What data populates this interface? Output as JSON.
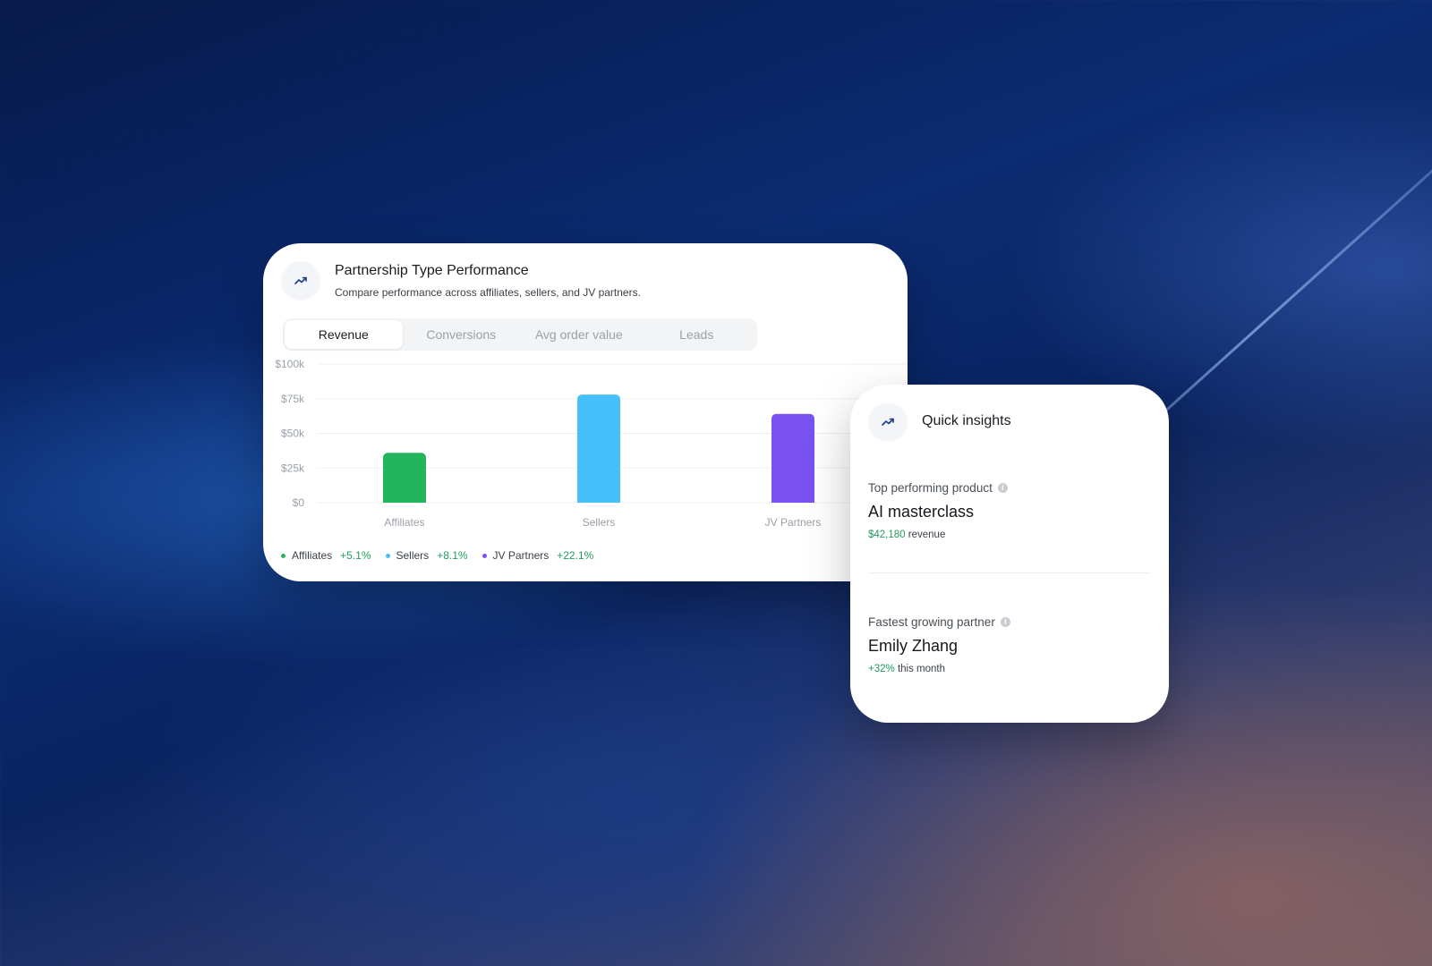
{
  "performance_card": {
    "title": "Partnership Type Performance",
    "subtitle": "Compare performance across affiliates, sellers, and JV partners.",
    "icon": "trending-up-icon",
    "tabs": [
      {
        "label": "Revenue",
        "active": true
      },
      {
        "label": "Conversions",
        "active": false
      },
      {
        "label": "Avg order value",
        "active": false
      },
      {
        "label": "Leads",
        "active": false
      }
    ],
    "legend": [
      {
        "name": "Affiliates",
        "change": "+5.1%",
        "color": "#22b55e"
      },
      {
        "name": "Sellers",
        "change": "+8.1%",
        "color": "#45c0fa"
      },
      {
        "name": "JV Partners",
        "change": "+22.1%",
        "color": "#7b52f2"
      }
    ]
  },
  "chart_data": {
    "type": "bar",
    "categories": [
      "Affiliates",
      "Sellers",
      "JV Partners"
    ],
    "values": [
      36000,
      78000,
      64000
    ],
    "colors": [
      "#22b55e",
      "#45c0fa",
      "#7b52f2"
    ],
    "ylim": [
      0,
      100000
    ],
    "yticks": [
      {
        "value": 0,
        "label": "$0"
      },
      {
        "value": 25000,
        "label": "$25k"
      },
      {
        "value": 50000,
        "label": "$50k"
      },
      {
        "value": 75000,
        "label": "$75k"
      },
      {
        "value": 100000,
        "label": "$100k"
      }
    ],
    "grid": true
  },
  "insights_card": {
    "title": "Quick insights",
    "icon": "trending-up-icon",
    "top_product": {
      "label": "Top performing product",
      "value": "AI masterclass",
      "amount": "$42,180",
      "amount_suffix": "revenue"
    },
    "fastest_partner": {
      "label": "Fastest growing partner",
      "value": "Emily Zhang",
      "change": "+32%",
      "change_suffix": "this month"
    }
  }
}
